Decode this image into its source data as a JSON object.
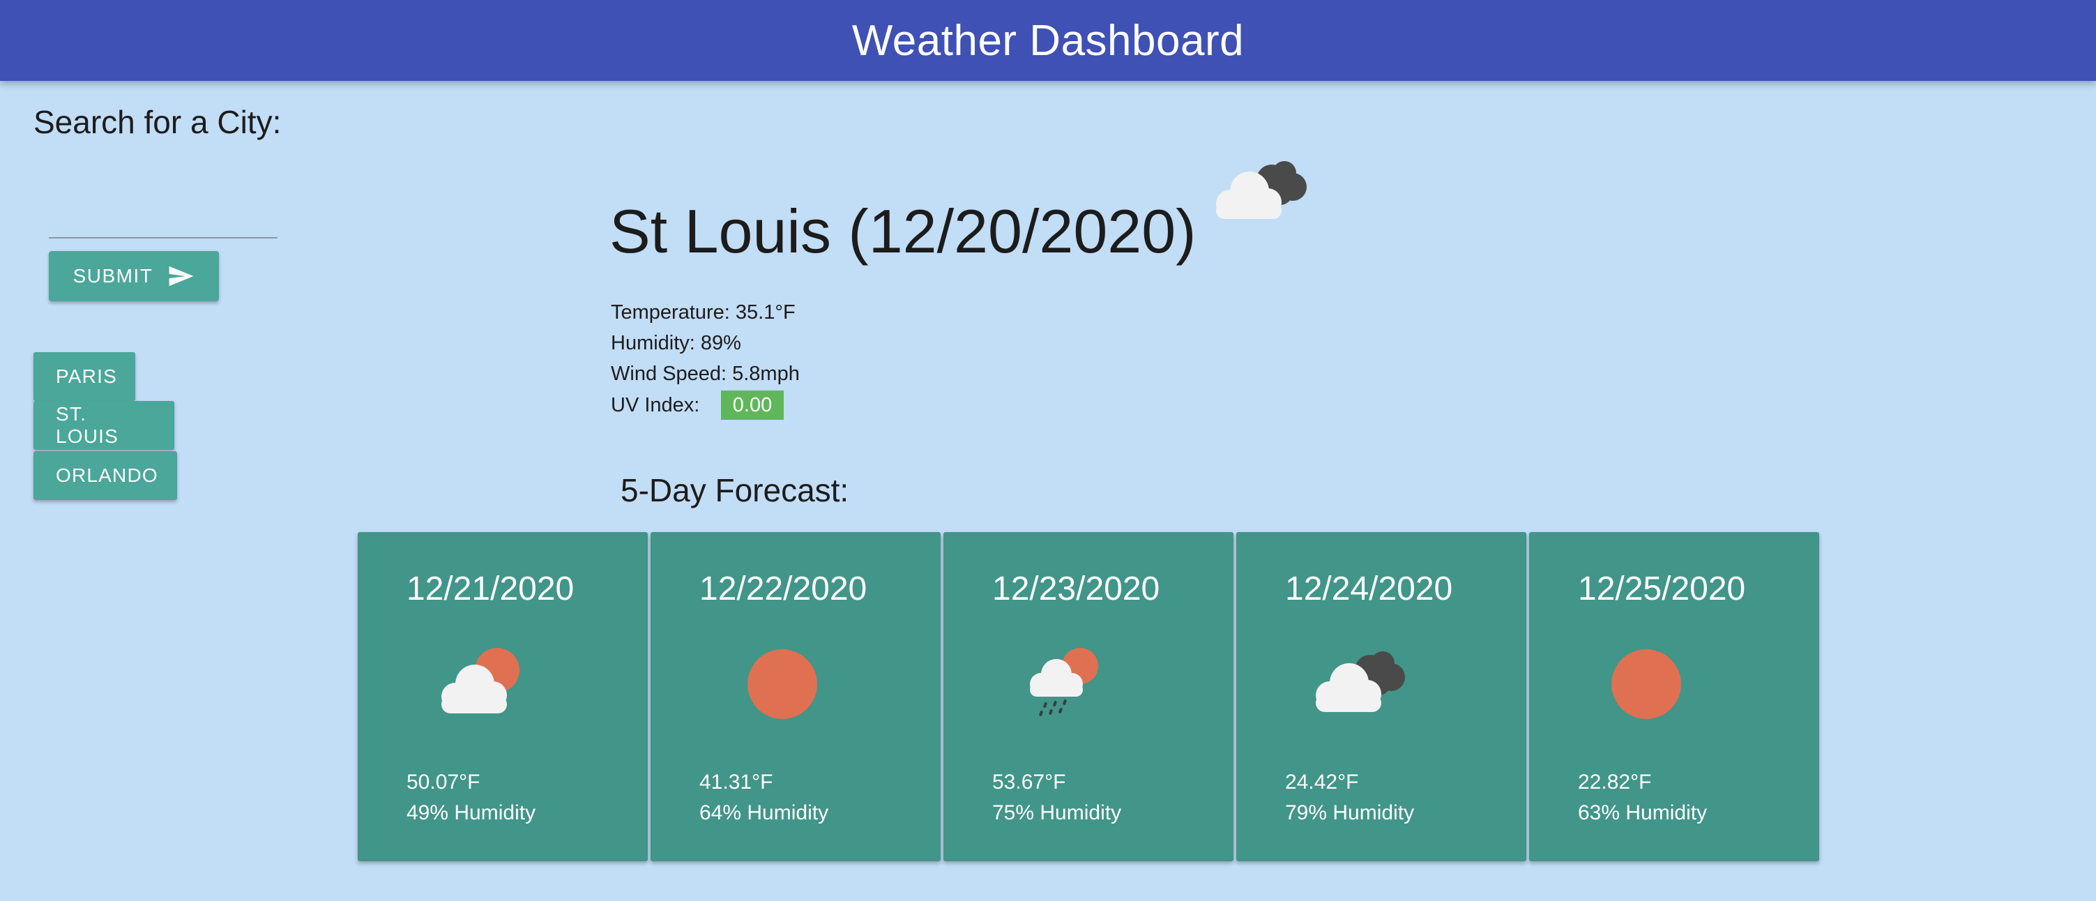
{
  "header": {
    "title": "Weather Dashboard"
  },
  "search": {
    "label": "Search for a City:",
    "input_value": "",
    "submit_label": "SUBMIT",
    "submit_icon": "send-icon"
  },
  "history": [
    {
      "label": "PARIS"
    },
    {
      "label": "ST. LOUIS"
    },
    {
      "label": "ORLANDO"
    }
  ],
  "current": {
    "title": "St Louis (12/20/2020)",
    "icon": "cloudy-icon",
    "temperature": "Temperature: 35.1°F",
    "humidity": "Humidity: 89%",
    "wind": "Wind Speed: 5.8mph",
    "uv_label": "UV Index:",
    "uv_value": "0.00",
    "uv_color": "#5fb75a"
  },
  "forecast": {
    "title": "5-Day Forecast:",
    "days": [
      {
        "date": "12/21/2020",
        "icon": "partly-cloudy-icon",
        "temp": "50.07°F",
        "humidity": "49% Humidity"
      },
      {
        "date": "12/22/2020",
        "icon": "sun-icon",
        "temp": "41.31°F",
        "humidity": "64% Humidity"
      },
      {
        "date": "12/23/2020",
        "icon": "rain-icon",
        "temp": "53.67°F",
        "humidity": "75% Humidity"
      },
      {
        "date": "12/24/2020",
        "icon": "cloudy-icon",
        "temp": "24.42°F",
        "humidity": "79% Humidity"
      },
      {
        "date": "12/25/2020",
        "icon": "sun-icon",
        "temp": "22.82°F",
        "humidity": "63% Humidity"
      }
    ]
  },
  "colors": {
    "header": "#3f51b5",
    "background": "#c2ddf6",
    "button": "#4aa79a",
    "card": "#419589",
    "sun": "#e07052"
  }
}
